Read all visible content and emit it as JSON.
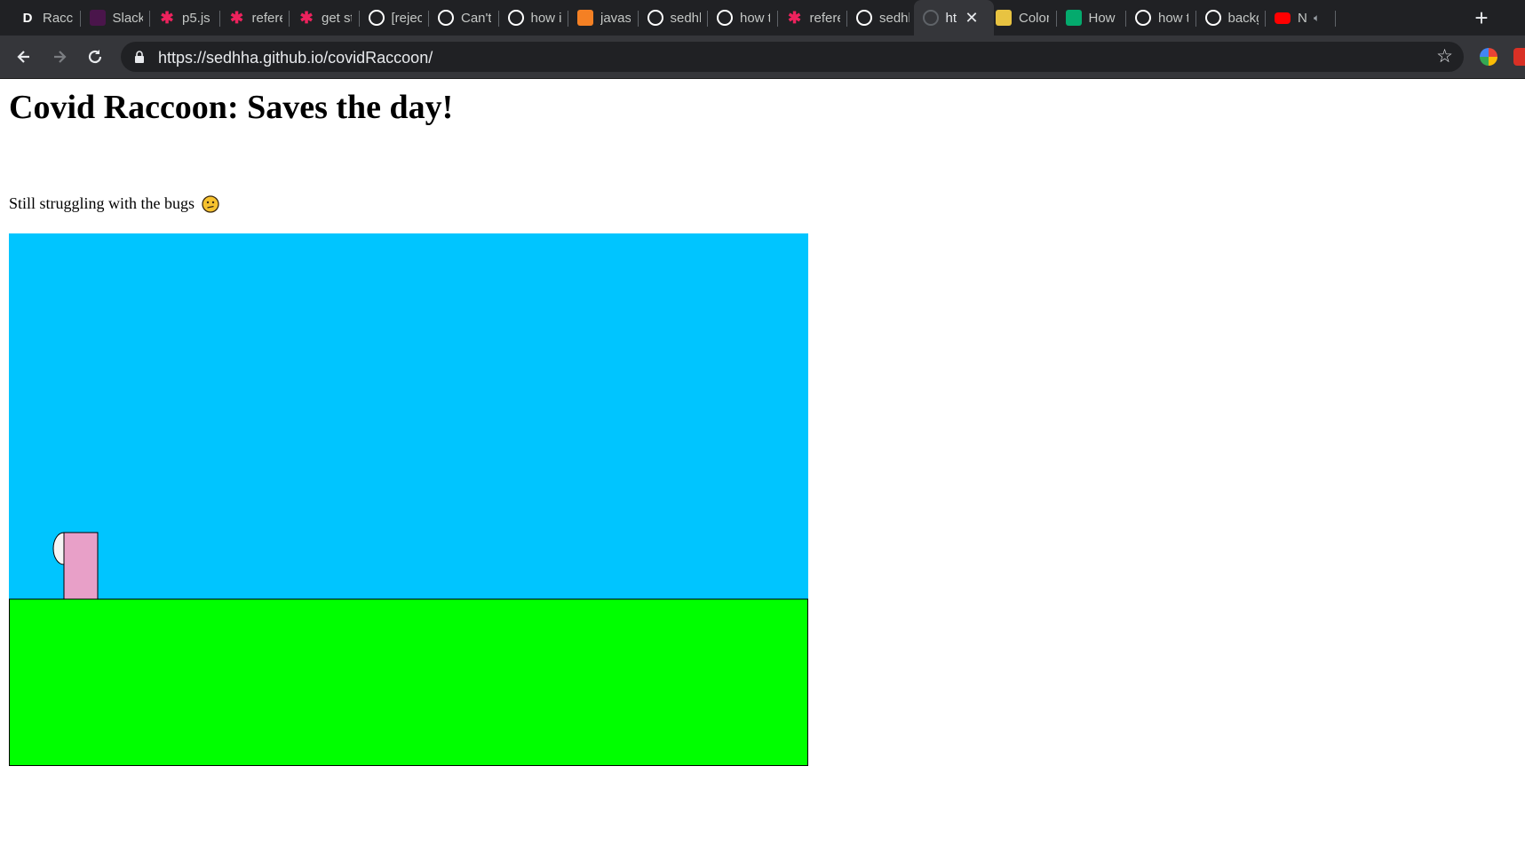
{
  "browser": {
    "tabs": [
      {
        "title": "Racco",
        "icon": "d-letter-icon",
        "icon_color": "#ffffff",
        "letter": "D"
      },
      {
        "title": "Slack",
        "icon": "slack-icon",
        "icon_color": "#4a154b"
      },
      {
        "title": "p5.js",
        "icon": "p5-star-icon",
        "icon_color": "#ed225d"
      },
      {
        "title": "refere",
        "icon": "p5-star-icon",
        "icon_color": "#ed225d"
      },
      {
        "title": "get st",
        "icon": "p5-star-icon",
        "icon_color": "#ed225d"
      },
      {
        "title": "[rejec",
        "icon": "github-icon",
        "icon_color": "#ffffff"
      },
      {
        "title": "Can't",
        "icon": "github-icon",
        "icon_color": "#ffffff"
      },
      {
        "title": "how i",
        "icon": "google-icon",
        "icon_color": "#ffffff"
      },
      {
        "title": "javas",
        "icon": "stackoverflow-icon",
        "icon_color": "#f48024"
      },
      {
        "title": "sedhh",
        "icon": "github-icon",
        "icon_color": "#ffffff"
      },
      {
        "title": "how t",
        "icon": "google-icon",
        "icon_color": "#ffffff"
      },
      {
        "title": "refere",
        "icon": "p5-star-icon",
        "icon_color": "#ed225d"
      },
      {
        "title": "sedhh",
        "icon": "github-icon",
        "icon_color": "#ffffff"
      },
      {
        "title": "ht",
        "icon": "globe-icon",
        "icon_color": "#5f6368",
        "active": true
      },
      {
        "title": "Color",
        "icon": "shield-icon",
        "icon_color": "#e8c341"
      },
      {
        "title": "How",
        "icon": "w3schools-icon",
        "icon_color": "#04aa6d"
      },
      {
        "title": "how t",
        "icon": "google-icon",
        "icon_color": "#ffffff"
      },
      {
        "title": "backg",
        "icon": "google-icon",
        "icon_color": "#ffffff"
      },
      {
        "title": "N",
        "icon": "youtube-icon",
        "icon_color": "#ff0000",
        "audio": true
      }
    ],
    "url": "https://sedhha.github.io/covidRaccoon/"
  },
  "page": {
    "heading": "Covid Raccoon: Saves the day!",
    "note": "Still struggling with the bugs",
    "note_emoji": "confused-face-emoji"
  },
  "game": {
    "sky_color": "#00c5ff",
    "ground_color": "#00ff00",
    "player_color": "#e8a0c8",
    "player_head_color": "#f5f5f5"
  }
}
